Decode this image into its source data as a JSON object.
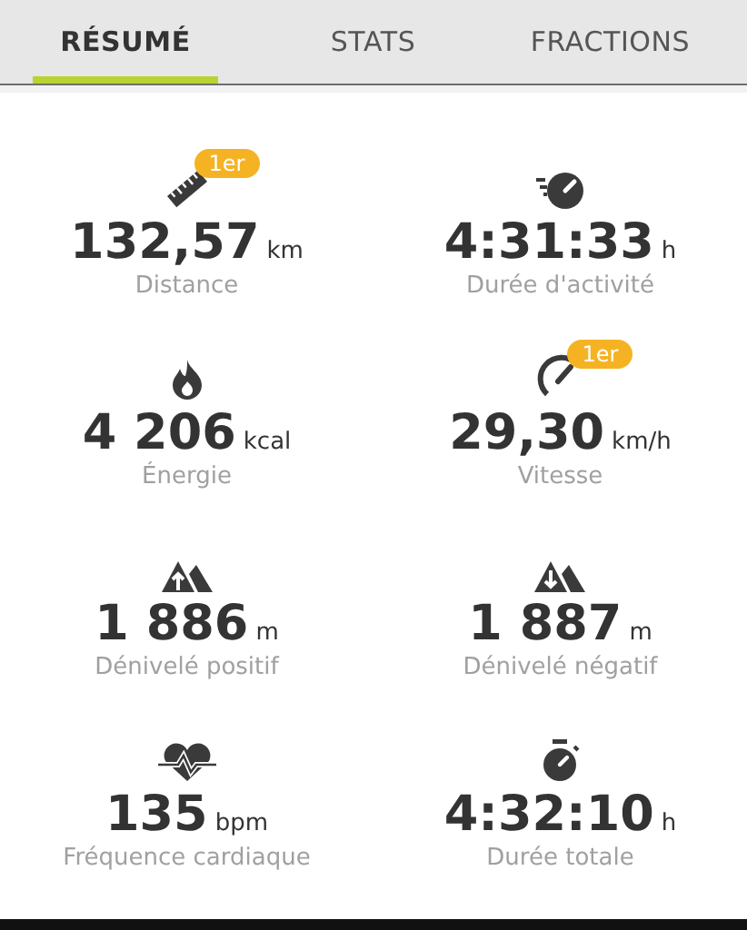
{
  "tabs": [
    {
      "label": "RÉSUMÉ",
      "selected": true
    },
    {
      "label": "STATS",
      "selected": false
    },
    {
      "label": "FRACTIONS",
      "selected": false
    }
  ],
  "rows": [
    {
      "metrics": [
        {
          "kind": "ruler",
          "badge": "1er",
          "value": "132,57",
          "unit": "km",
          "label": "Distance"
        },
        {
          "kind": "speedometer",
          "value": "4:31:33",
          "unit": "h",
          "label": "Durée d'activité"
        }
      ]
    },
    {
      "metrics": [
        {
          "kind": "flame",
          "value": "4 206",
          "unit": "kcal",
          "label": "Énergie"
        },
        {
          "kind": "gauge",
          "badge": "1er",
          "value": "29,30",
          "unit": "km/h",
          "label": "Vitesse"
        }
      ]
    },
    {
      "metrics": [
        {
          "kind": "ascent",
          "value": "1 886",
          "unit": "m",
          "label": "Dénivelé positif"
        },
        {
          "kind": "descent",
          "value": "1 887",
          "unit": "m",
          "label": "Dénivelé négatif"
        }
      ]
    },
    {
      "metrics": [
        {
          "kind": "heart",
          "value": "135",
          "unit": "bpm",
          "label": "Fréquence cardiaque"
        },
        {
          "kind": "stopwatch",
          "value": "4:32:10",
          "unit": "h",
          "label": "Durée totale"
        }
      ]
    }
  ]
}
